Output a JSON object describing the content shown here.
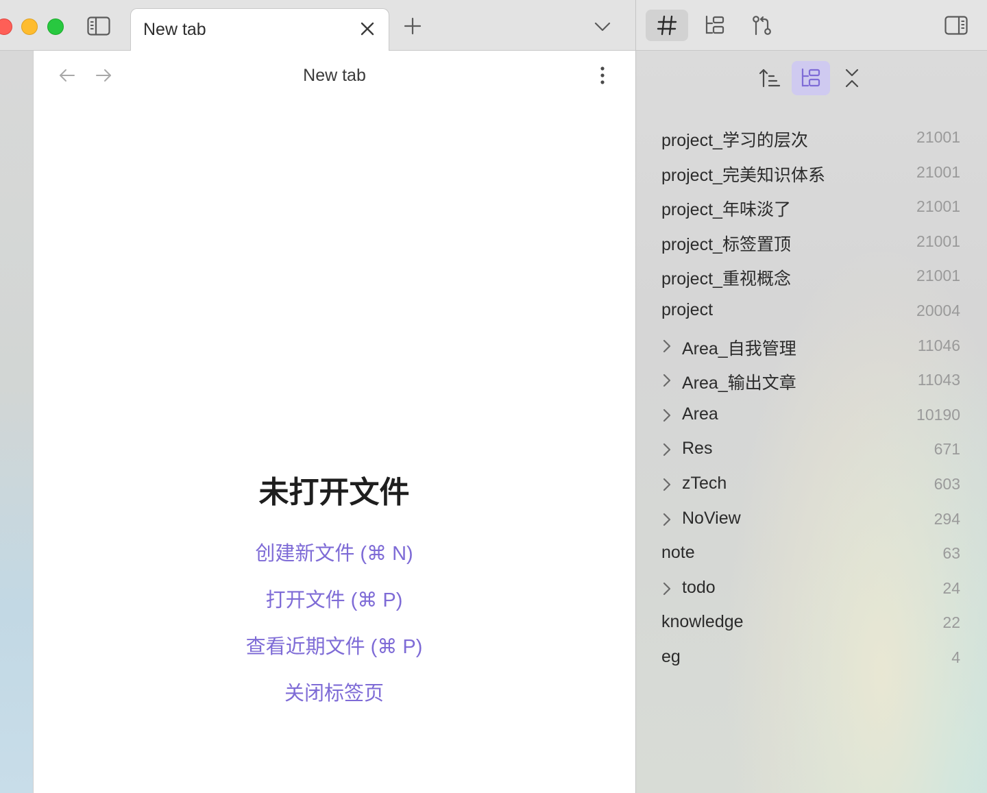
{
  "tabbar": {
    "active_tab_title": "New tab"
  },
  "editor": {
    "view_title": "New tab",
    "empty_state": {
      "title": "未打开文件",
      "actions": [
        "创建新文件 (⌘ N)",
        "打开文件 (⌘ P)",
        "查看近期文件 (⌘ P)",
        "关闭标签页"
      ]
    }
  },
  "right_sidebar": {
    "tabs": [
      "tags-icon",
      "file-tree-icon",
      "git-branch-icon"
    ],
    "active_tab": "tags-icon",
    "tools": [
      "sort-icon",
      "nested-tags-icon",
      "collapse-icon"
    ],
    "active_tool": "nested-tags-icon",
    "tags": [
      {
        "name": "project_学习的层次",
        "count": "21001",
        "nested": false
      },
      {
        "name": "project_完美知识体系",
        "count": "21001",
        "nested": false
      },
      {
        "name": "project_年味淡了",
        "count": "21001",
        "nested": false
      },
      {
        "name": "project_标签置顶",
        "count": "21001",
        "nested": false
      },
      {
        "name": "project_重视概念",
        "count": "21001",
        "nested": false
      },
      {
        "name": "project",
        "count": "20004",
        "nested": false
      },
      {
        "name": "Area_自我管理",
        "count": "11046",
        "nested": true
      },
      {
        "name": "Area_输出文章",
        "count": "11043",
        "nested": true
      },
      {
        "name": "Area",
        "count": "10190",
        "nested": true
      },
      {
        "name": "Res",
        "count": "671",
        "nested": true
      },
      {
        "name": "zTech",
        "count": "603",
        "nested": true
      },
      {
        "name": "NoView",
        "count": "294",
        "nested": true
      },
      {
        "name": "note",
        "count": "63",
        "nested": false
      },
      {
        "name": "todo",
        "count": "24",
        "nested": true
      },
      {
        "name": "knowledge",
        "count": "22",
        "nested": false
      },
      {
        "name": "eg",
        "count": "4",
        "nested": false
      }
    ]
  },
  "colors": {
    "accent": "#7e6bd6",
    "accent_bg": "#cfcaf0"
  }
}
